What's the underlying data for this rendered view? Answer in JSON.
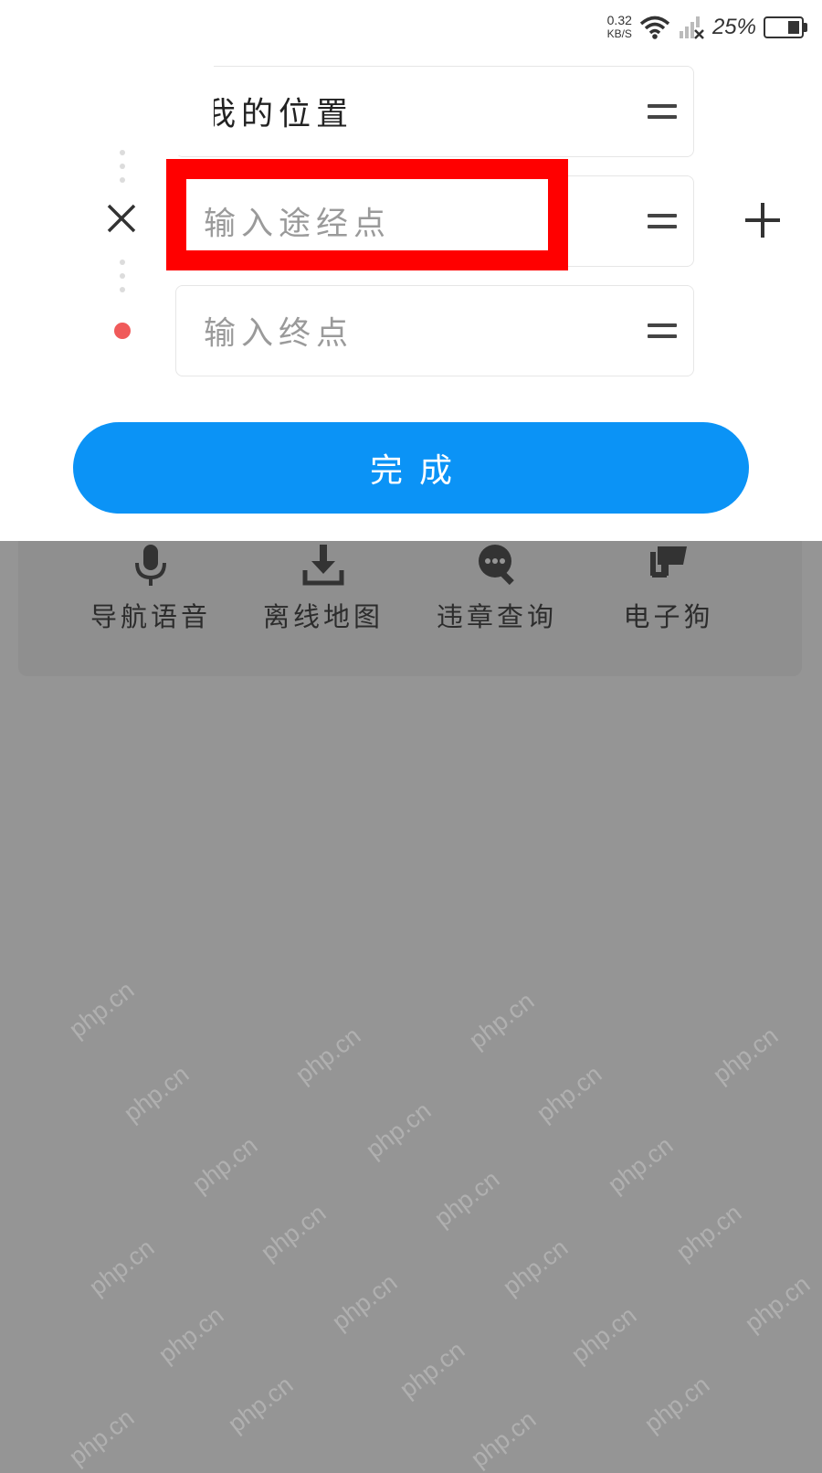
{
  "status_bar": {
    "net_speed": "0.32",
    "net_unit": "KB/S",
    "battery": "25%"
  },
  "route": {
    "start_value": "我的位置",
    "waypoint_placeholder": "输入途经点",
    "end_placeholder": "输入终点"
  },
  "done_label": "完成",
  "shortcuts": [
    {
      "label": "导航语音",
      "icon": "microphone-icon"
    },
    {
      "label": "离线地图",
      "icon": "download-icon"
    },
    {
      "label": "违章查询",
      "icon": "chat-search-icon"
    },
    {
      "label": "电子狗",
      "icon": "speed-camera-icon"
    }
  ],
  "watermark": "php.cn",
  "colors": {
    "accent": "#0b93f6",
    "end_marker": "#f05a5a",
    "highlight": "#ff0000",
    "overlay": "#959595"
  }
}
